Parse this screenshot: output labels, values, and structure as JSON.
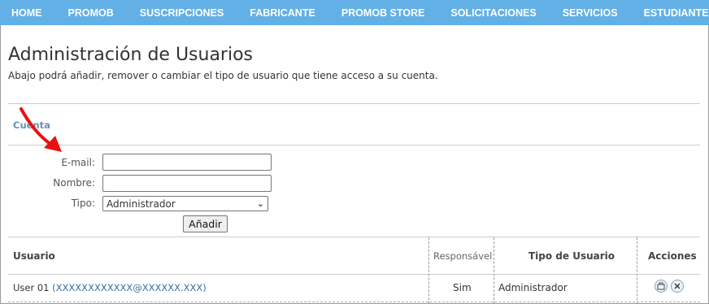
{
  "nav": {
    "items": [
      "HOME",
      "PROMOB",
      "SUSCRIPCIONES",
      "FABRICANTE",
      "PROMOB STORE",
      "SOLICITACIONES",
      "SERVICIOS",
      "ESTUDIANTE"
    ]
  },
  "header": {
    "title": "Administración de Usuarios",
    "subtitle": "Abajo podrá añadir, remover o cambiar el tipo de usuario que tiene acceso a su cuenta."
  },
  "tabs": {
    "account": "Cuenta"
  },
  "form": {
    "email_label": "E-mail:",
    "email_value": "",
    "name_label": "Nombre:",
    "name_value": "",
    "type_label": "Tipo:",
    "type_selected": "Administrador",
    "add_button": "Añadir"
  },
  "table": {
    "headers": {
      "user": "Usuario",
      "responsible": "Responsável",
      "user_type": "Tipo de Usuario",
      "actions": "Acciones"
    },
    "rows": [
      {
        "user_name": "User 01",
        "user_open": " (",
        "user_email": "XXXXXXXXXXXX@XXXXXX.XXX",
        "user_close": ")",
        "responsible": "Sim",
        "user_type": "Administrador"
      }
    ]
  },
  "colors": {
    "nav_bg": "#63b0e6",
    "annotation_arrow": "#e8110f",
    "link": "#3a6ea5"
  }
}
